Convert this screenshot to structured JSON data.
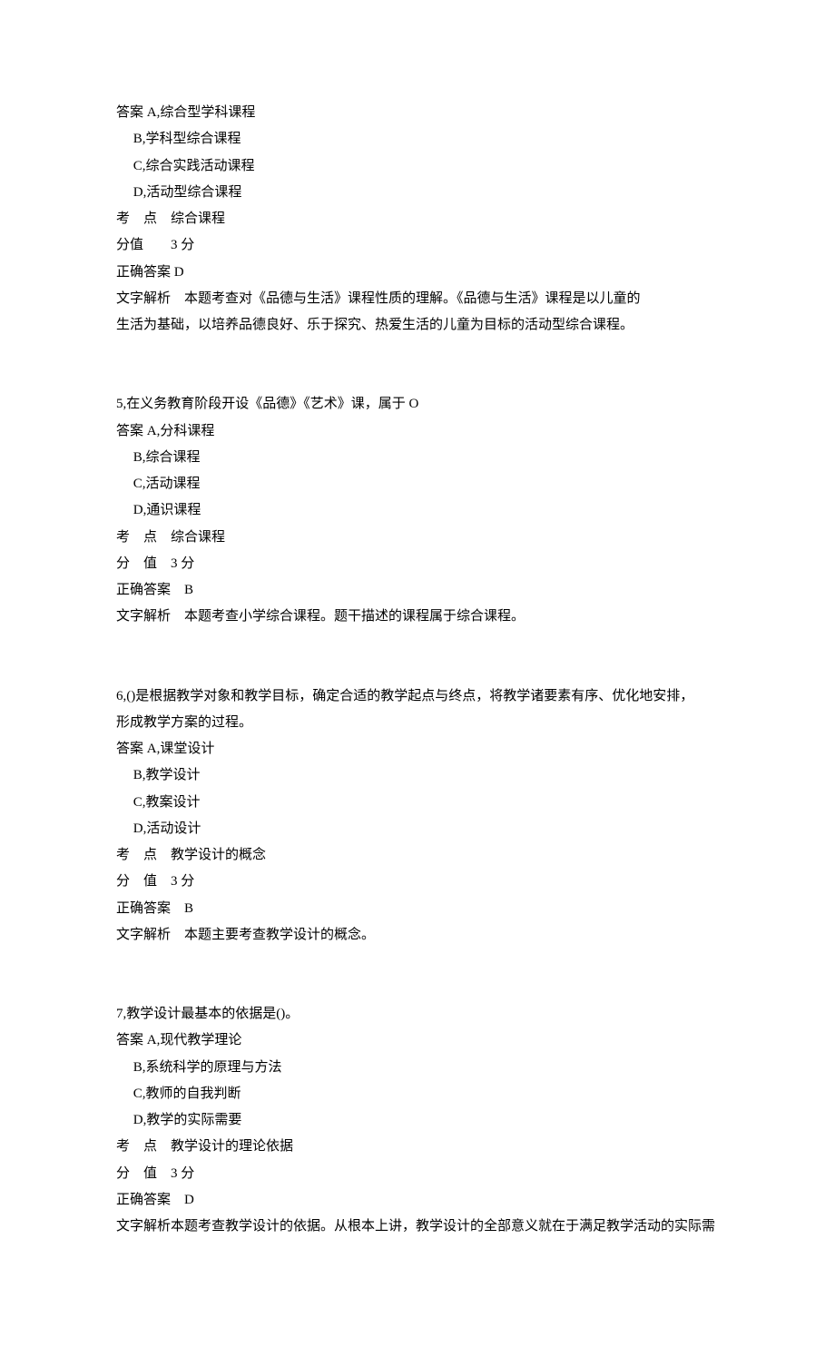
{
  "q4": {
    "answer_a": "答案 A,综合型学科课程",
    "b": "     B,学科型综合课程",
    "c": "     C,综合实践活动课程",
    "d": "     D,活动型综合课程",
    "kaodian": "考    点    综合课程",
    "fenzhi": "分值        3 分",
    "correct": "正确答案 D",
    "jiexi1": "文字解析    本题考查对《品德与生活》课程性质的理解。《品德与生活》课程是以儿童的",
    "jiexi2": "生活为基础，以培养品德良好、乐于探究、热爱生活的儿童为目标的活动型综合课程。"
  },
  "q5": {
    "stem": "5,在义务教育阶段开设《品德》《艺术》课，属于 O",
    "answer_a": "答案 A,分科课程",
    "b": "     B,综合课程",
    "c": "     C,活动课程",
    "d": "     D,通识课程",
    "kaodian": "考    点    综合课程",
    "fenzhi": "分    值    3 分",
    "correct": "正确答案    B",
    "jiexi": "文字解析    本题考查小学综合课程。题干描述的课程属于综合课程。"
  },
  "q6": {
    "stem1": "6,()是根据教学对象和教学目标，确定合适的教学起点与终点，将教学诸要素有序、优化地安排，",
    "stem2": "形成教学方案的过程。",
    "answer_a": "答案 A,课堂设计",
    "b": "     B,教学设计",
    "c": "     C,教案设计",
    "d": "     D,活动设计",
    "kaodian": "考    点    教学设计的概念",
    "fenzhi": "分    值    3 分",
    "correct": "正确答案    B",
    "jiexi": "文字解析    本题主要考查教学设计的概念。"
  },
  "q7": {
    "stem": "7,教学设计最基本的依据是()。",
    "answer_a": "答案 A,现代教学理论",
    "b": "     B,系统科学的原理与方法",
    "c": "     C,教师的自我判断",
    "d": "     D,教学的实际需要",
    "kaodian": "考    点    教学设计的理论依据",
    "fenzhi": "分    值    3 分",
    "correct": "正确答案    D",
    "jiexi": "文字解析本题考查教学设计的依据。从根本上讲，教学设计的全部意义就在于满足教学活动的实际需"
  }
}
